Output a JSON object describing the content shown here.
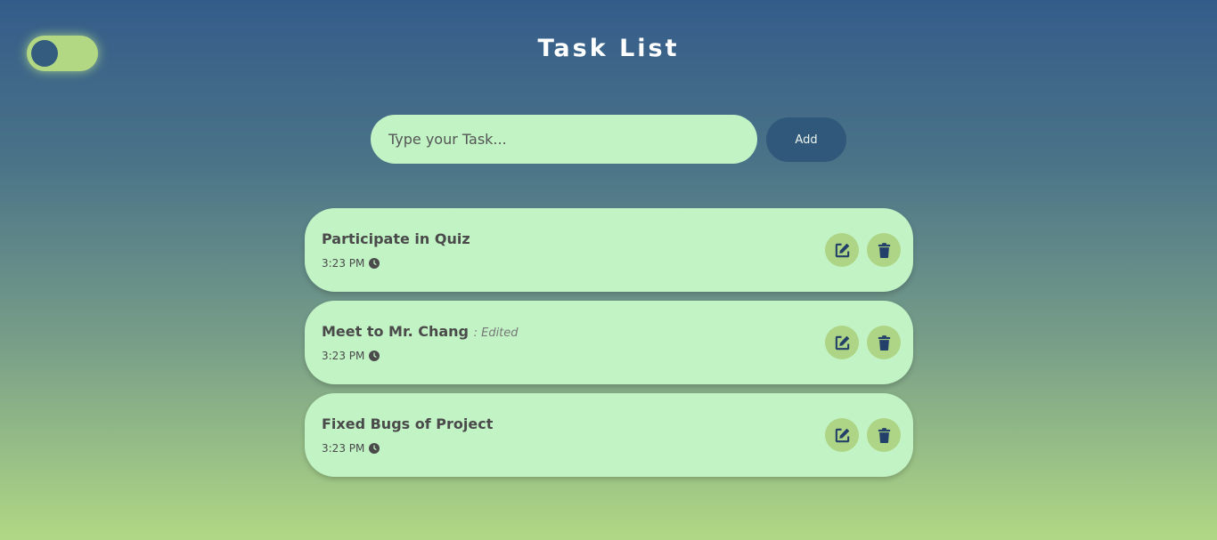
{
  "header": {
    "title": "Task List"
  },
  "theme_toggle": {
    "state": "off"
  },
  "input": {
    "placeholder": "Type your Task...",
    "value": "",
    "add_label": "Add"
  },
  "tasks": [
    {
      "text": "Participate in Quiz",
      "edited_label": "",
      "time": "3:23 PM"
    },
    {
      "text": "Meet to Mr. Chang",
      "edited_label": ": Edited",
      "time": "3:23 PM"
    },
    {
      "text": "Fixed Bugs of Project",
      "edited_label": "",
      "time": "3:23 PM"
    }
  ],
  "icons": {
    "task_edit": "edit-icon",
    "task_delete": "trash-icon",
    "task_time": "clock-icon"
  },
  "colors": {
    "accent_dark": "#2f587a",
    "card": "#c1f3c5",
    "icon_button": "#aed485",
    "toggle": "#b3d883"
  }
}
